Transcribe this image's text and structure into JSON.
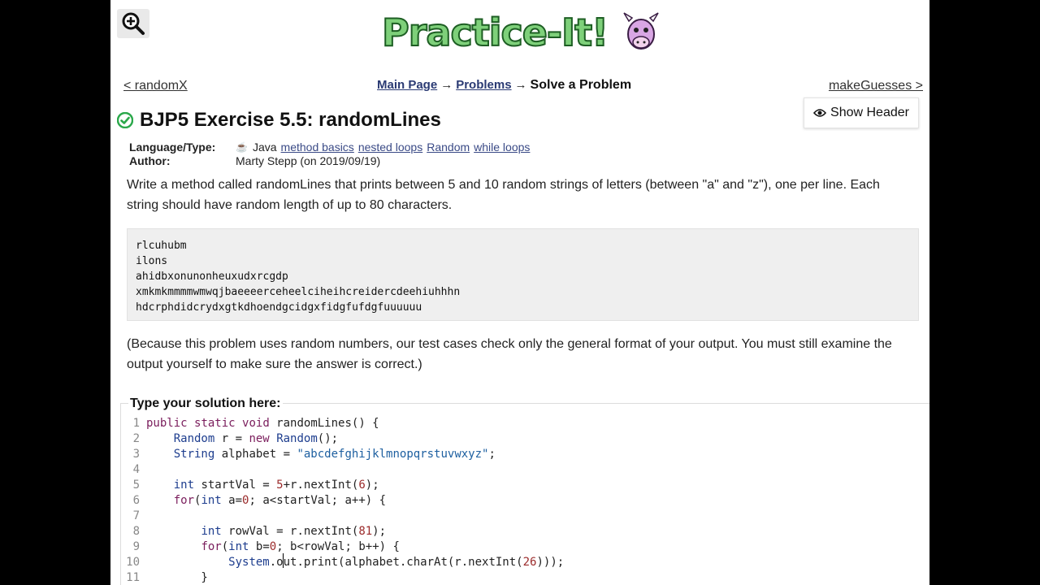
{
  "nav": {
    "prev_label": "< randomX",
    "next_label": "makeGuesses >",
    "crumb_main": "Main Page",
    "crumb_problems": "Problems",
    "crumb_current": "Solve a Problem",
    "arrow": "→"
  },
  "show_header_label": "Show Header",
  "problem": {
    "title": "BJP5 Exercise 5.5: randomLines",
    "language_label": "Language/Type:",
    "language": "Java",
    "tags": [
      "method basics",
      "nested loops",
      "Random",
      "while loops"
    ],
    "author_label": "Author:",
    "author": "Marty Stepp (on 2019/09/19)",
    "description": "Write a method called randomLines that prints between 5 and 10 random strings of letters (between \"a\" and \"z\"), one per line. Each string should have random length of up to 80 characters.",
    "sample_output": "rlcuhubm\nilons\nahidbxonunonheuxudxrcgdp\nxmkmkmmmmwmwqjbaeeeerceheelciheihcreidercdeehiuhhhn\nhdcrphdidcrydxgtkdhoendgcidgxfidgfufdgfuuuuuu",
    "note": "(Because this problem uses random numbers, our test cases check only the general format of your output. You must still examine the output yourself to make sure the answer is correct.)"
  },
  "solution_label": "Type your solution here:",
  "code_lines": [
    "public static void randomLines() {",
    "    Random r = new Random();",
    "    String alphabet = \"abcdefghijklmnopqrstuvwxyz\";",
    "",
    "    int startVal = 5+r.nextInt(6);",
    "    for(int a=0; a<startVal; a++) {",
    "",
    "        int rowVal = r.nextInt(81);",
    "        for(int b=0; b<rowVal; b++) {",
    "            System.out.print(alphabet.charAt(r.nextInt(26)));",
    "        }"
  ],
  "line_numbers": [
    "1",
    "2",
    "3",
    "4",
    "5",
    "6",
    "7",
    "8",
    "9",
    "10",
    "11"
  ],
  "colors": {
    "accent_green": "#2aa84a",
    "link_blue": "#3a4a86",
    "keyword": "#7a1d5c",
    "type": "#1d3d8e"
  },
  "icons": [
    "zoom-in-icon",
    "practice-it-logo",
    "eye-icon",
    "check-circle-icon",
    "java-cup-icon"
  ]
}
